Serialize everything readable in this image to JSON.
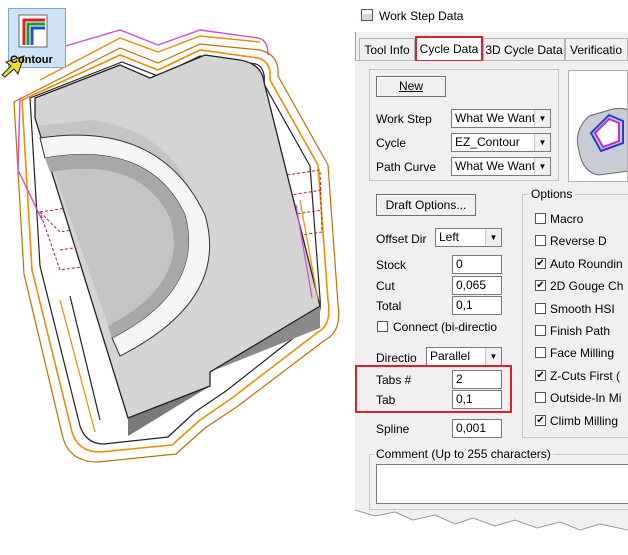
{
  "toolbar": {
    "contour_label": "Contour"
  },
  "dialog": {
    "title": "Work Step Data",
    "tabs": [
      {
        "label": "Tool Info"
      },
      {
        "label": "Cycle Data",
        "selected": true
      },
      {
        "label": "3D Cycle Data"
      },
      {
        "label": "Verificatio"
      }
    ],
    "new_button": "New",
    "work_step": {
      "label": "Work Step",
      "value": "What We Want"
    },
    "cycle": {
      "label": "Cycle",
      "value": "EZ_Contour"
    },
    "path_curve": {
      "label": "Path Curve",
      "value": "What We Want"
    },
    "draft_button": "Draft Options...",
    "offset_dir": {
      "label": "Offset Dir",
      "value": "Left"
    },
    "stock": {
      "label": "Stock",
      "value": "0"
    },
    "cut": {
      "label": "Cut",
      "value": "0,065"
    },
    "total": {
      "label": "Total",
      "value": "0,1"
    },
    "connect": {
      "label": "Connect (bi-directio",
      "checked": false
    },
    "direction": {
      "label": "Directio",
      "value": "Parallel"
    },
    "tabs_count": {
      "label": "Tabs #",
      "value": "2"
    },
    "tab": {
      "label": "Tab",
      "value": "0,1"
    },
    "spline": {
      "label": "Spline",
      "value": "0,001"
    },
    "comment_label": "Comment  (Up to 255 characters)",
    "options": {
      "title": "Options",
      "items": [
        {
          "label": "Macro",
          "checked": false
        },
        {
          "label": "Reverse D",
          "checked": false
        },
        {
          "label": "Auto Roundin",
          "checked": true
        },
        {
          "label": "2D Gouge Ch",
          "checked": true
        },
        {
          "label": "Smooth HSI",
          "checked": false
        },
        {
          "label": "Finish Path",
          "checked": false
        },
        {
          "label": "Face Milling",
          "checked": false
        },
        {
          "label": "Z-Cuts First (",
          "checked": true
        },
        {
          "label": "Outside-In Mi",
          "checked": false
        },
        {
          "label": "Climb Milling",
          "checked": true
        }
      ]
    }
  },
  "colors": {
    "highlight": "#e0202a",
    "part_top": "#d4d4d4",
    "toolpath_orange": "#f08c00",
    "toolpath_magenta": "#d24bd2"
  }
}
